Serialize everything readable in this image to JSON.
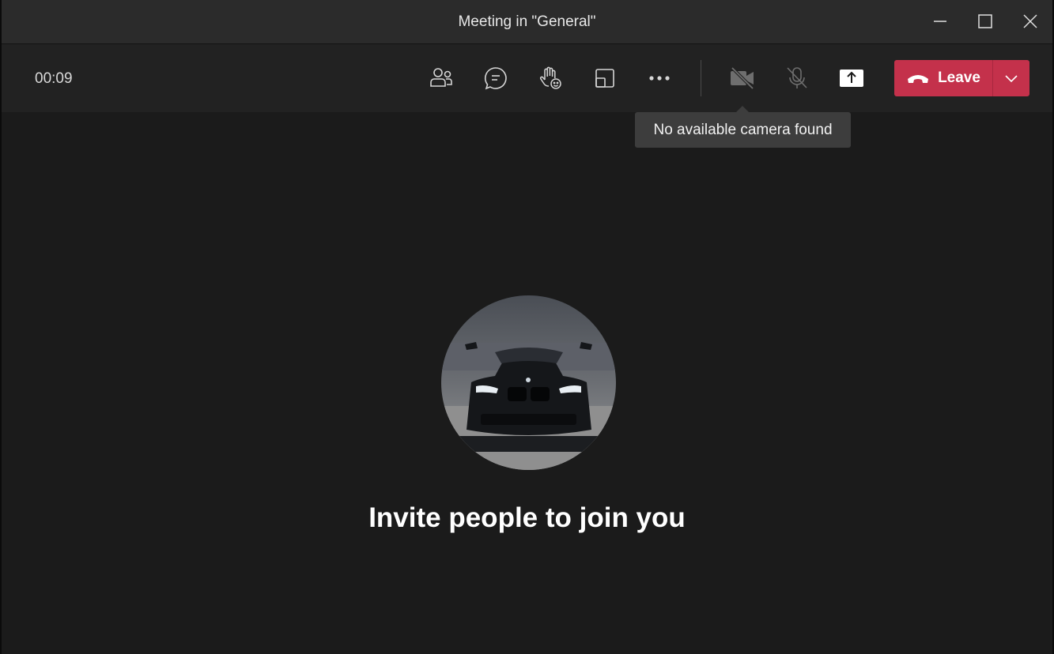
{
  "window": {
    "title": "Meeting in \"General\"",
    "controls": [
      "minimize-icon",
      "maximize-icon",
      "close-icon"
    ]
  },
  "toolbar": {
    "timer": "00:09",
    "buttons": [
      {
        "icon": "people-icon"
      },
      {
        "icon": "chat-icon"
      },
      {
        "icon": "raise-hand-react-icon"
      },
      {
        "icon": "rooms-icon"
      },
      {
        "icon": "more-options-icon"
      },
      {
        "icon": "camera-off-icon",
        "state": "disabled"
      },
      {
        "icon": "mic-off-icon",
        "state": "disabled"
      },
      {
        "icon": "share-screen-icon"
      }
    ],
    "leave": {
      "label": "Leave",
      "icon": "hang-up-phone-icon",
      "color": "#c4314b"
    }
  },
  "tooltip": {
    "text": "No available camera found"
  },
  "main": {
    "avatar_subject": "black car photo",
    "invite_text": "Invite people to join you"
  }
}
